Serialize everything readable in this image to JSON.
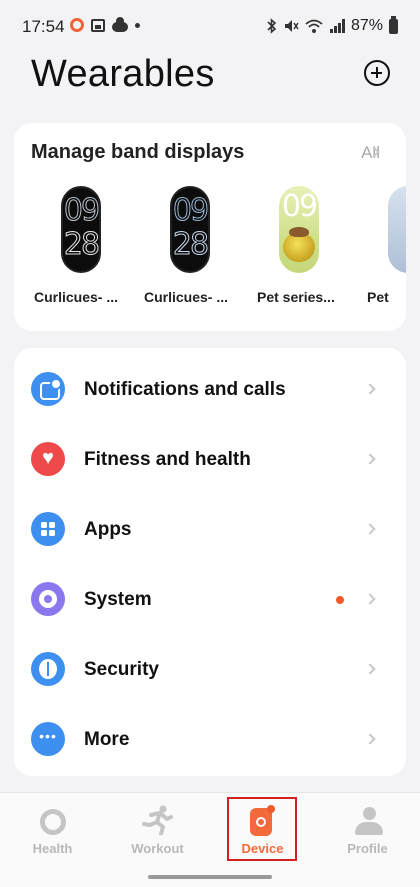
{
  "status_bar": {
    "time": "17:54",
    "battery": "87%",
    "left_icons": [
      "recording-ring-icon",
      "gallery-icon",
      "cloud-icon",
      "dot-icon"
    ],
    "right_icons": [
      "bluetooth-icon",
      "mute-icon",
      "wifi-icon",
      "signal-icon",
      "battery-icon"
    ]
  },
  "header": {
    "title": "Wearables",
    "add_icon": "plus-circle-icon"
  },
  "band_displays": {
    "title": "Manage band displays",
    "all_label": "All",
    "items": [
      {
        "label": "Curlicues- ...",
        "digits_top": "09",
        "digits_bottom": "28"
      },
      {
        "label": "Curlicues- ...",
        "digits_top": "09",
        "digits_bottom": "28"
      },
      {
        "label": "Pet series...",
        "digits_top": "09"
      },
      {
        "label": "Pet"
      }
    ]
  },
  "menu": {
    "items": [
      {
        "label": "Notifications and calls",
        "icon": "notification-icon",
        "color": "#3d8ff0"
      },
      {
        "label": "Fitness and health",
        "icon": "heart-icon",
        "color": "#ef4a4a"
      },
      {
        "label": "Apps",
        "icon": "apps-grid-icon",
        "color": "#3d8ff0"
      },
      {
        "label": "System",
        "icon": "system-icon",
        "color": "#8b78ee",
        "has_badge": true
      },
      {
        "label": "Security",
        "icon": "shield-icon",
        "color": "#3d8ff0"
      },
      {
        "label": "More",
        "icon": "more-icon",
        "color": "#3d8ff0"
      }
    ]
  },
  "bottom_nav": {
    "items": [
      {
        "label": "Health",
        "icon": "health-ring-icon"
      },
      {
        "label": "Workout",
        "icon": "running-icon"
      },
      {
        "label": "Device",
        "icon": "watch-icon",
        "active": true
      },
      {
        "label": "Profile",
        "icon": "profile-icon"
      }
    ],
    "accent_color": "#f26a3a"
  }
}
